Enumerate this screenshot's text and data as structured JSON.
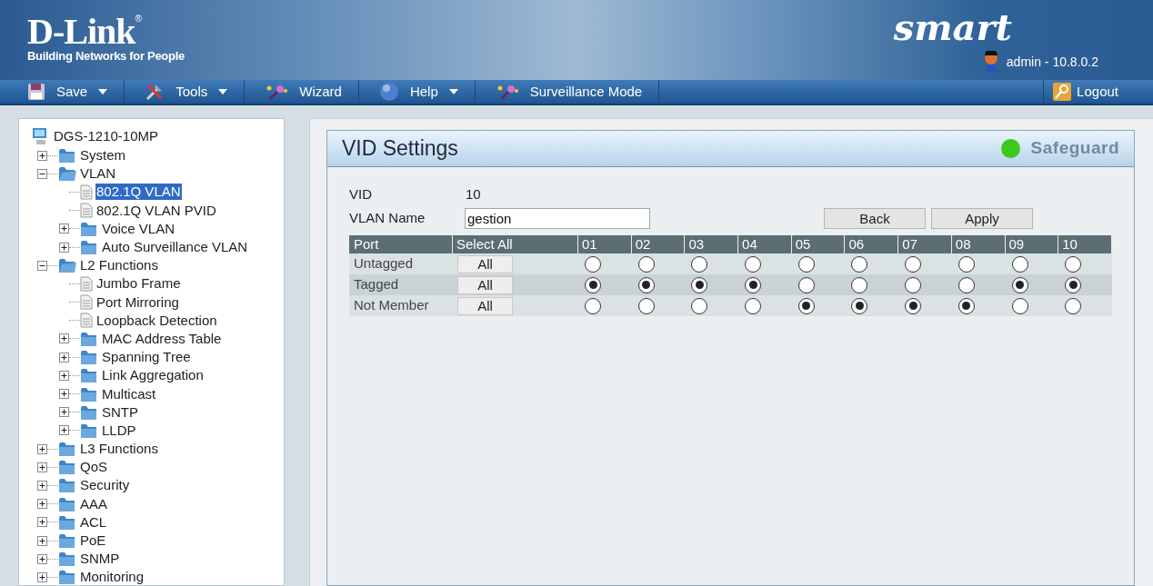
{
  "header": {
    "logo": "D-Link",
    "logo_mark": "®",
    "tagline": "Building Networks for People",
    "product": "smart",
    "user": "admin - 10.8.0.2"
  },
  "toolbar": [
    {
      "label": "Save",
      "kind": "save",
      "dropdown": true
    },
    {
      "label": "Tools",
      "kind": "tools",
      "dropdown": true
    },
    {
      "label": "Wizard",
      "kind": "wand",
      "dropdown": false
    },
    {
      "label": "Help",
      "kind": "help",
      "dropdown": true
    },
    {
      "label": "Surveillance Mode",
      "kind": "wand",
      "dropdown": false
    }
  ],
  "logout": "Logout",
  "tree": {
    "label": "DGS-1210-10MP",
    "children": [
      {
        "label": "System",
        "kind": "folder",
        "expanded": false,
        "selected": false
      },
      {
        "label": "VLAN",
        "kind": "folder",
        "expanded": true,
        "selected": false,
        "children": [
          {
            "label": "802.1Q VLAN",
            "kind": "page",
            "selected": true
          },
          {
            "label": "802.1Q VLAN PVID",
            "kind": "page",
            "selected": false
          },
          {
            "label": "Voice VLAN",
            "kind": "folder",
            "expanded": false,
            "selected": false
          },
          {
            "label": "Auto Surveillance VLAN",
            "kind": "folder",
            "expanded": false,
            "selected": false
          }
        ]
      },
      {
        "label": "L2 Functions",
        "kind": "folder",
        "expanded": true,
        "selected": false,
        "children": [
          {
            "label": "Jumbo Frame",
            "kind": "page",
            "selected": false
          },
          {
            "label": "Port Mirroring",
            "kind": "page",
            "selected": false
          },
          {
            "label": "Loopback Detection",
            "kind": "page",
            "selected": false
          },
          {
            "label": "MAC Address Table",
            "kind": "folder",
            "expanded": false,
            "selected": false
          },
          {
            "label": "Spanning Tree",
            "kind": "folder",
            "expanded": false,
            "selected": false
          },
          {
            "label": "Link Aggregation",
            "kind": "folder",
            "expanded": false,
            "selected": false
          },
          {
            "label": "Multicast",
            "kind": "folder",
            "expanded": false,
            "selected": false
          },
          {
            "label": "SNTP",
            "kind": "folder",
            "expanded": false,
            "selected": false
          },
          {
            "label": "LLDP",
            "kind": "folder",
            "expanded": false,
            "selected": false
          }
        ]
      },
      {
        "label": "L3 Functions",
        "kind": "folder",
        "expanded": false,
        "selected": false
      },
      {
        "label": "QoS",
        "kind": "folder",
        "expanded": false,
        "selected": false
      },
      {
        "label": "Security",
        "kind": "folder",
        "expanded": false,
        "selected": false
      },
      {
        "label": "AAA",
        "kind": "folder",
        "expanded": false,
        "selected": false
      },
      {
        "label": "ACL",
        "kind": "folder",
        "expanded": false,
        "selected": false
      },
      {
        "label": "PoE",
        "kind": "folder",
        "expanded": false,
        "selected": false
      },
      {
        "label": "SNMP",
        "kind": "folder",
        "expanded": false,
        "selected": false
      },
      {
        "label": "Monitoring",
        "kind": "folder",
        "expanded": false,
        "selected": false
      }
    ]
  },
  "panel": {
    "title": "VID Settings",
    "safeguard": "Safeguard",
    "safeguard_on": true,
    "vid_label": "VID",
    "vid": "10",
    "name_label": "VLAN Name",
    "name_value": "gestion",
    "buttons": [
      "Back",
      "Apply"
    ],
    "columns": [
      "Port",
      "Select All",
      "01",
      "02",
      "03",
      "04",
      "05",
      "06",
      "07",
      "08",
      "09",
      "10"
    ],
    "rows": [
      {
        "label": "Untagged",
        "button": "All",
        "ports": [
          {
            "selected": false
          },
          {
            "selected": false
          },
          {
            "selected": false
          },
          {
            "selected": false
          },
          {
            "selected": false
          },
          {
            "selected": false
          },
          {
            "selected": false
          },
          {
            "selected": false
          },
          {
            "selected": false
          },
          {
            "selected": false
          }
        ]
      },
      {
        "label": "Tagged",
        "button": "All",
        "ports": [
          {
            "selected": true
          },
          {
            "selected": true
          },
          {
            "selected": true
          },
          {
            "selected": true
          },
          {
            "selected": false
          },
          {
            "selected": false
          },
          {
            "selected": false
          },
          {
            "selected": false
          },
          {
            "selected": true
          },
          {
            "selected": true
          }
        ]
      },
      {
        "label": "Not Member",
        "button": "All",
        "ports": [
          {
            "selected": false
          },
          {
            "selected": false
          },
          {
            "selected": false
          },
          {
            "selected": false
          },
          {
            "selected": true
          },
          {
            "selected": true
          },
          {
            "selected": true
          },
          {
            "selected": true
          },
          {
            "selected": false
          },
          {
            "selected": false
          }
        ]
      }
    ]
  }
}
